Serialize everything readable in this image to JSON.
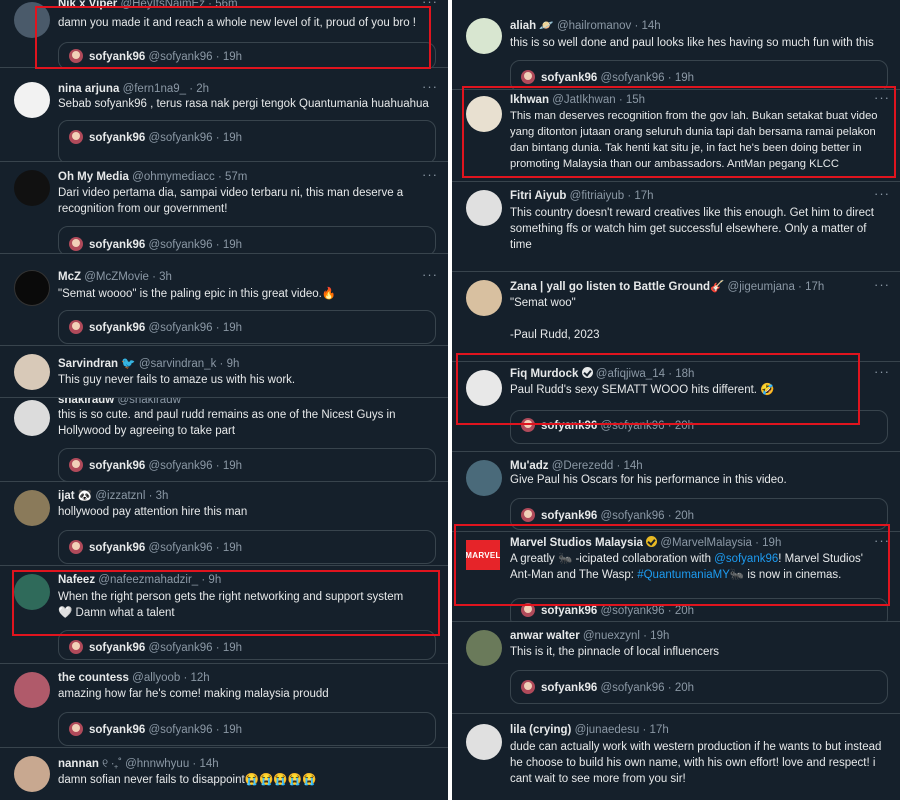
{
  "left": [
    {
      "name": "Nik x Viper",
      "handle": "@HeyItsNaimEz",
      "time": "56m",
      "text": "damn you made it and reach a whole new level of it, proud of you bro !",
      "quote": "19h",
      "avatar": "#4a5a6a"
    },
    {
      "name": "nina arjuna",
      "handle": "@fern1na9_",
      "time": "2h",
      "text": "Sebab sofyank96 , terus rasa nak pergi tengok Quantumania huahuahua",
      "quote": "19h",
      "avatar": "#f2f2f2"
    },
    {
      "name": "Oh My Media",
      "handle": "@ohmymediacc",
      "time": "57m",
      "text": "Dari video pertama dia, sampai video terbaru ni, this man deserve a recognition from our government!",
      "quote": "19h",
      "avatar": "#111111"
    },
    {
      "name": "McZ",
      "handle": "@McZMovie",
      "time": "3h",
      "text": "\"Semat woooo\" is the paling epic in this great video.🔥",
      "quote": "19h",
      "avatar": "#0a0a0a"
    },
    {
      "name": "Sarvindran",
      "handle": "@sarvindran_k",
      "time": "9h",
      "text": "This guy never fails to amaze us with his work.",
      "avatar": "#d8c9b8"
    },
    {
      "name": "shakiradw",
      "handle": "@shakiradw",
      "time": "",
      "text": "this is so cute. and paul rudd remains as one of the Nicest Guys in Hollywood by agreeing to take part",
      "quote": "19h",
      "avatar": "#dcdcdc"
    },
    {
      "name": "ijat",
      "handle": "@izzatznl",
      "time": "3h",
      "text": "hollywood pay attention hire this man",
      "quote": "19h",
      "avatar": "#8a7a5a"
    },
    {
      "name": "Nafeez",
      "handle": "@nafeezmahadzir_",
      "time": "9h",
      "text": "When the right person gets the right networking and support system🤍 Damn what a talent",
      "quote": "19h",
      "avatar": "#2f6a5a"
    },
    {
      "name": "the countess",
      "handle": "@allyoob",
      "time": "12h",
      "text": "amazing how far he's come! making malaysia proudd",
      "quote": "19h",
      "avatar": "#b05a6a"
    },
    {
      "name": "nannan",
      "handle": "@hnnwhyuu",
      "time": "14h",
      "text": "damn sofian never fails to disappoint😭😭😭😭😭",
      "avatar": "#c8a890"
    }
  ],
  "right": [
    {
      "name": "aliah",
      "handle": "@hailromanov",
      "time": "14h",
      "text": "this is so well done and paul looks like hes having so much fun with this",
      "quote": "19h",
      "avatar": "#d8e6d0"
    },
    {
      "name": "Ikhwan",
      "handle": "@JatIkhwan",
      "time": "15h",
      "text": "This man deserves recognition from the gov lah. Bukan setakat buat video yang ditonton jutaan orang seluruh dunia tapi dah bersama ramai pelakon dan bintang dunia. Tak henti kat situ je, in fact he's been doing better in promoting Malaysia than our ambassadors. AntMan pegang KLCC",
      "avatar": "#e8e0d0"
    },
    {
      "name": "Fitri Aiyub",
      "handle": "@fitriaiyub",
      "time": "17h",
      "text": "This country doesn't reward creatives like this enough. Get him to direct something ffs or watch him get successful elsewhere. Only a matter of time",
      "avatar": "#e0e0e0"
    },
    {
      "name": "Zana | yall go listen to Battle Ground",
      "handle": "@jigeumjana",
      "time": "17h",
      "text": "\"Semat woo\"",
      "text2": "-Paul Rudd, 2023",
      "avatar": "#d8c0a0"
    },
    {
      "name": "Fiq Murdock",
      "handle": "@afiqjiwa_14",
      "time": "18h",
      "text": "Paul Rudd's sexy SEMATT WOOO hits different. 🤣",
      "quote": "20h",
      "avatar": "#e8e8e8"
    },
    {
      "name": "Mu'adz",
      "handle": "@Derezedd",
      "time": "14h",
      "text": "Give Paul his Oscars for his performance in this video.",
      "quote": "20h",
      "avatar": "#4a6a7a"
    },
    {
      "name": "Marvel Studios Malaysia",
      "handle": "@MarvelMalaysia",
      "time": "19h",
      "text_a": "A greatly 🐜 -icipated collaboration with ",
      "mention": "@sofyank96",
      "text_b": "! Marvel Studios' Ant-Man and The Wasp: ",
      "hashtag": "#QuantumaniaMY",
      "text_c": "🐜 is now in cinemas.",
      "logo": "MARVEL",
      "quote": "20h",
      "avatar": "#e62429"
    },
    {
      "name": "anwar walter",
      "handle": "@nuexzynl",
      "time": "19h",
      "text": "This is it, the pinnacle of local influencers",
      "quote": "20h",
      "avatar": "#6a7a5a"
    },
    {
      "name": "lila (crying)",
      "handle": "@junaedesu",
      "time": "17h",
      "text": "dude can actually work with western production if he wants to but instead he choose to build his own name, with his own effort! love and respect! i cant wait to see more from you sir!",
      "avatar": "#e0e0e0"
    }
  ],
  "quoted": {
    "name": "sofyank96",
    "handle": "@sofyank96"
  },
  "colors": {
    "background": "#15202b",
    "text": "#e7e9ea",
    "muted": "#8b98a5",
    "link": "#1d9bf0",
    "highlight": "#e0141e"
  }
}
